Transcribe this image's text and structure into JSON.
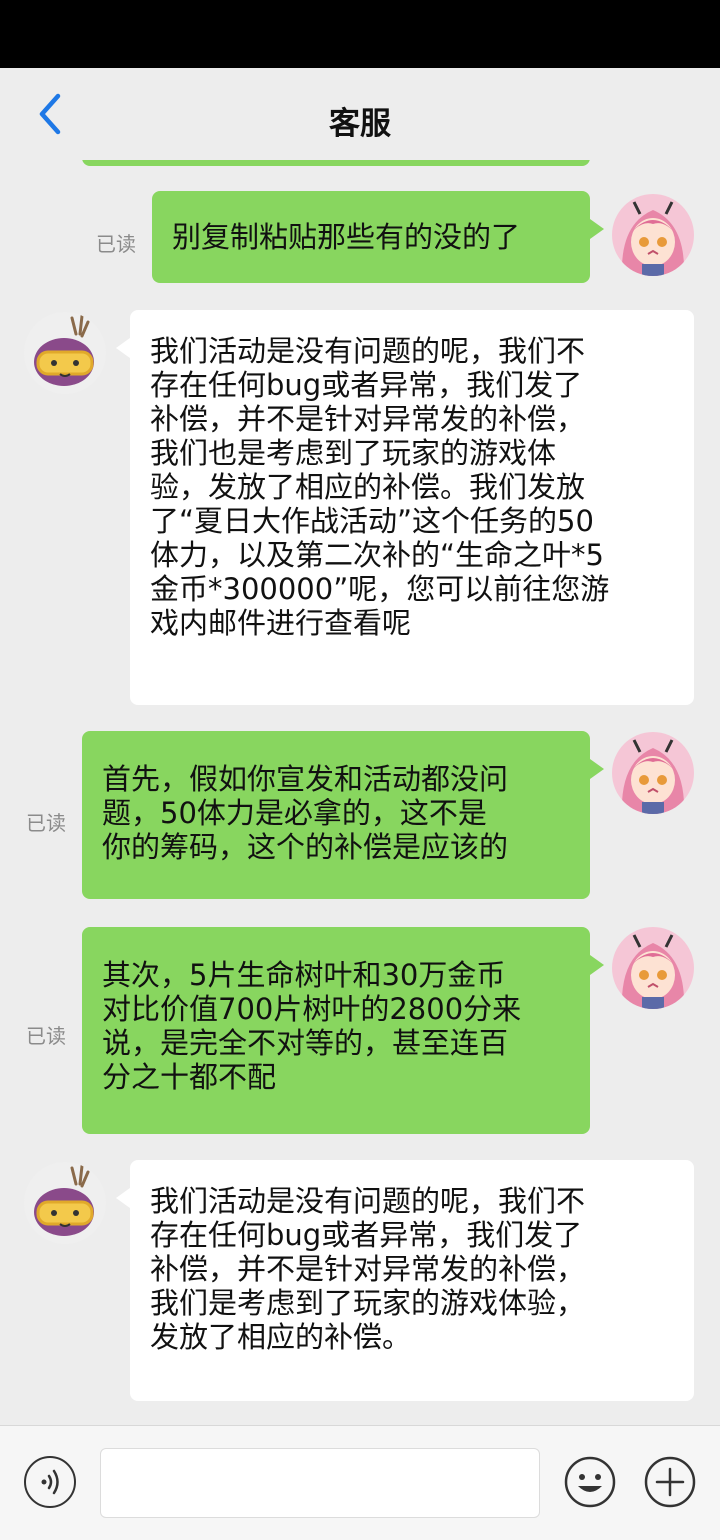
{
  "header": {
    "title": "客服"
  },
  "messages": [
    {
      "side": "right",
      "read": "已读",
      "text": "别复制粘贴那些有的没的了"
    },
    {
      "side": "left",
      "text": "我们活动是没有问题的呢，我们不\n存在任何bug或者异常，我们发了\n补偿，并不是针对异常发的补偿，\n我们也是考虑到了玩家的游戏体\n验，发放了相应的补偿。我们发放\n了“夏日大作战活动”这个任务的50\n体力，以及第二次补的“生命之叶*5\n金币*300000”呢，您可以前往您游\n戏内邮件进行查看呢"
    },
    {
      "side": "right",
      "read": "已读",
      "text": "首先，假如你宣发和活动都没问\n题，50体力是必拿的，这不是\n你的筹码，这个的补偿是应该的"
    },
    {
      "side": "right",
      "read": "已读",
      "text": "其次，5片生命树叶和30万金币\n对比价值700片树叶的2800分来\n说，是完全不对等的，甚至连百\n分之十都不配"
    },
    {
      "side": "left",
      "text": "我们活动是没有问题的呢，我们不\n存在任何bug或者异常，我们发了\n补偿，并不是针对异常发的补偿，\n我们是考虑到了玩家的游戏体验，\n发放了相应的补偿。"
    }
  ],
  "input": {
    "placeholder": ""
  },
  "colors": {
    "bubble_sent": "#88d65f",
    "bubble_received": "#ffffff",
    "back_arrow": "#1e78e6"
  }
}
